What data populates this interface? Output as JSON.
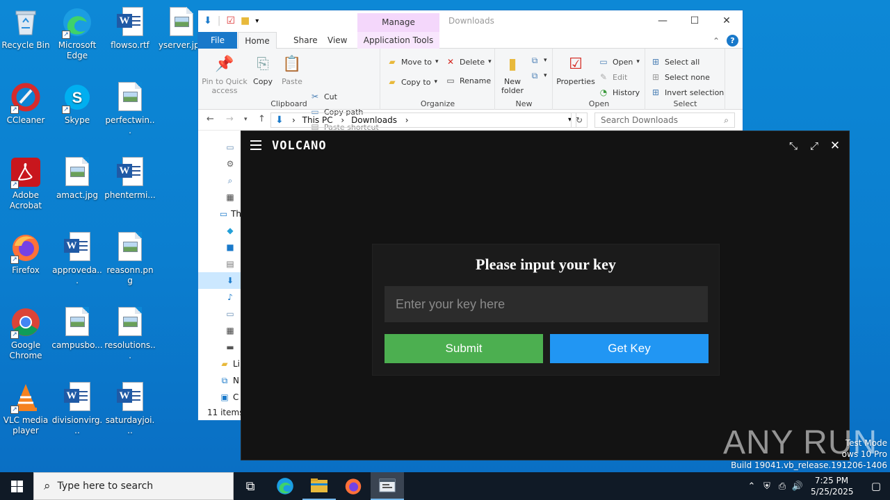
{
  "desktop": {
    "icons": [
      {
        "label": "Recycle Bin"
      },
      {
        "label": "Microsoft Edge"
      },
      {
        "label": "flowso.rtf"
      },
      {
        "label": "yserver.jpg"
      },
      {
        "label": "CCleaner"
      },
      {
        "label": "Skype"
      },
      {
        "label": "perfectwin..."
      },
      {
        "label": "Adobe Acrobat"
      },
      {
        "label": "amact.jpg"
      },
      {
        "label": "phentermi..."
      },
      {
        "label": "Firefox"
      },
      {
        "label": "approveda..."
      },
      {
        "label": "reasonn.png"
      },
      {
        "label": "Google Chrome"
      },
      {
        "label": "campusbo..."
      },
      {
        "label": "resolutions..."
      },
      {
        "label": "VLC media player"
      },
      {
        "label": "divisionvirg..."
      },
      {
        "label": "saturdayjoi..."
      }
    ]
  },
  "explorer": {
    "title": "Downloads",
    "manage_tab": "Manage",
    "tabs": {
      "file": "File",
      "home": "Home",
      "share": "Share",
      "view": "View",
      "app_tools": "Application Tools"
    },
    "ribbon": {
      "clipboard": {
        "label": "Clipboard",
        "pin": "Pin to Quick access",
        "copy": "Copy",
        "paste": "Paste",
        "cut": "Cut",
        "copy_path": "Copy path",
        "paste_shortcut": "Paste shortcut"
      },
      "organize": {
        "label": "Organize",
        "move_to": "Move to",
        "copy_to": "Copy to",
        "delete": "Delete",
        "rename": "Rename"
      },
      "new": {
        "label": "New",
        "new_folder": "New folder"
      },
      "open": {
        "label": "Open",
        "properties": "Properties",
        "open": "Open",
        "edit": "Edit",
        "history": "History"
      },
      "select": {
        "label": "Select",
        "select_all": "Select all",
        "select_none": "Select none",
        "invert": "Invert selection"
      }
    },
    "address": {
      "segments": [
        "This PC",
        "Downloads"
      ],
      "search_placeholder": "Search Downloads"
    },
    "nav_partial": [
      "Th",
      "Li",
      "N",
      "C"
    ],
    "status": "11 items"
  },
  "volcano": {
    "title": "VOLCANO",
    "prompt": "Please input your key",
    "input_placeholder": "Enter your key here",
    "submit_label": "Submit",
    "getkey_label": "Get Key",
    "colors": {
      "submit": "#4caf50",
      "getkey": "#2196f3",
      "background": "#131313"
    }
  },
  "watermark": {
    "brand": "ANY RUN",
    "line1": "Test Mode",
    "line2": "ows 10 Pro",
    "line3": "Build 19041.vb_release.191206-1406"
  },
  "taskbar": {
    "search_placeholder": "Type here to search",
    "time": "7:25 PM",
    "date": "5/25/2025"
  }
}
